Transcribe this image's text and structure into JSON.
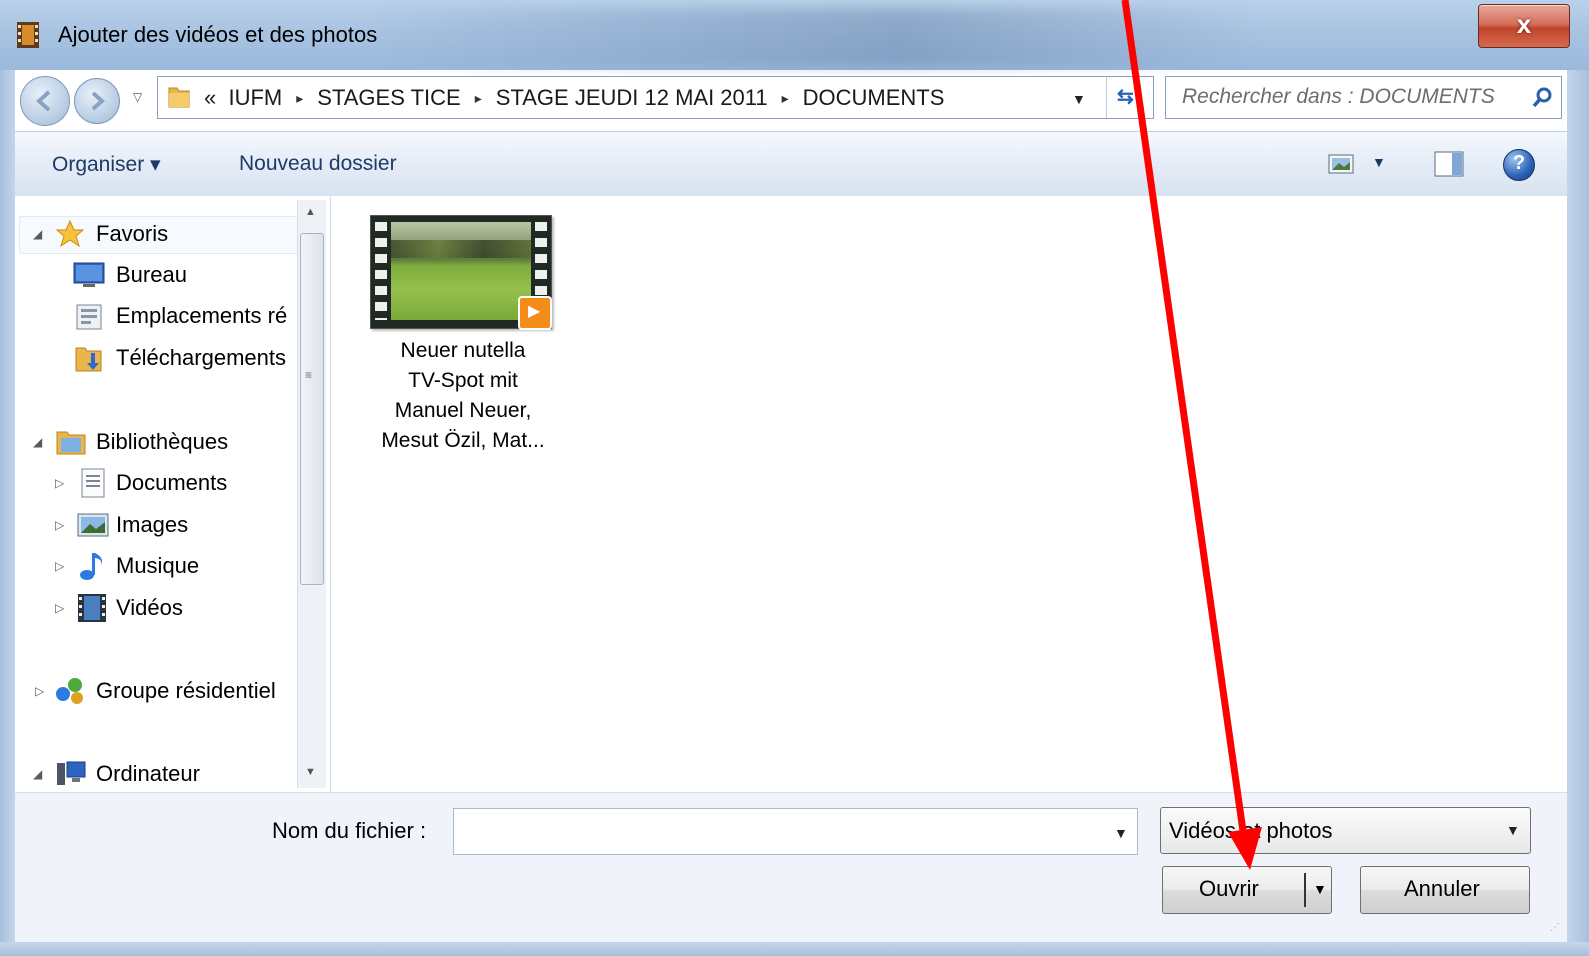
{
  "window": {
    "title": "Ajouter des vidéos et des photos",
    "close_label": "x"
  },
  "address": {
    "recent_pages_glyph": "▽",
    "overflow": "«",
    "crumbs": [
      "IUFM",
      "STAGES TICE",
      "STAGE JEUDI 12 MAI 2011",
      "DOCUMENTS"
    ],
    "separator": "▸",
    "dropdown_glyph": "▼",
    "refresh_glyph": "⇆"
  },
  "search": {
    "placeholder": "Rechercher dans : DOCUMENTS"
  },
  "toolbar": {
    "organize_label": "Organiser ▾",
    "new_folder_label": "Nouveau dossier",
    "view_dropdown_glyph": "▼",
    "help_glyph": "?"
  },
  "navpane": {
    "items": [
      {
        "label": "Favoris",
        "icon": "star-icon",
        "expander": "◢"
      },
      {
        "label": "Bureau",
        "icon": "desktop-icon"
      },
      {
        "label": "Emplacements ré",
        "icon": "recent-places-icon"
      },
      {
        "label": "Téléchargements",
        "icon": "downloads-folder-icon"
      },
      {
        "label": "Bibliothèques",
        "icon": "libraries-icon",
        "expander": "◢"
      },
      {
        "label": "Documents",
        "icon": "documents-icon",
        "expander": "▷"
      },
      {
        "label": "Images",
        "icon": "images-icon",
        "expander": "▷"
      },
      {
        "label": "Musique",
        "icon": "music-icon",
        "expander": "▷"
      },
      {
        "label": "Vidéos",
        "icon": "videos-icon",
        "expander": "▷"
      },
      {
        "label": "Groupe résidentiel",
        "icon": "homegroup-icon",
        "expander": "▷"
      },
      {
        "label": "Ordinateur",
        "icon": "computer-icon",
        "expander": "◢"
      }
    ],
    "scroll_up": "▲",
    "scroll_down": "▼",
    "scroll_grip": "≡"
  },
  "files": [
    {
      "name": "Neuer nutella TV-Spot mit Manuel Neuer, Mesut Özil, Mat...",
      "lines": [
        "Neuer nutella",
        "TV-Spot mit",
        "Manuel Neuer,",
        "Mesut Özil, Mat..."
      ],
      "type": "video"
    }
  ],
  "footer": {
    "filename_label": "Nom du fichier :",
    "filename_value": "",
    "filename_dropdown_glyph": "▼",
    "filetype_value": "Vidéos et photos",
    "filetype_dropdown_glyph": "▼",
    "open_label": "Ouvrir",
    "open_split_glyph": "▼",
    "cancel_label": "Annuler",
    "resize_grip": "⋰"
  },
  "colors": {
    "annotation_arrow": "#ff0000",
    "titlebar": "#a9c4e2",
    "toolbar_text": "#1e3a66"
  }
}
